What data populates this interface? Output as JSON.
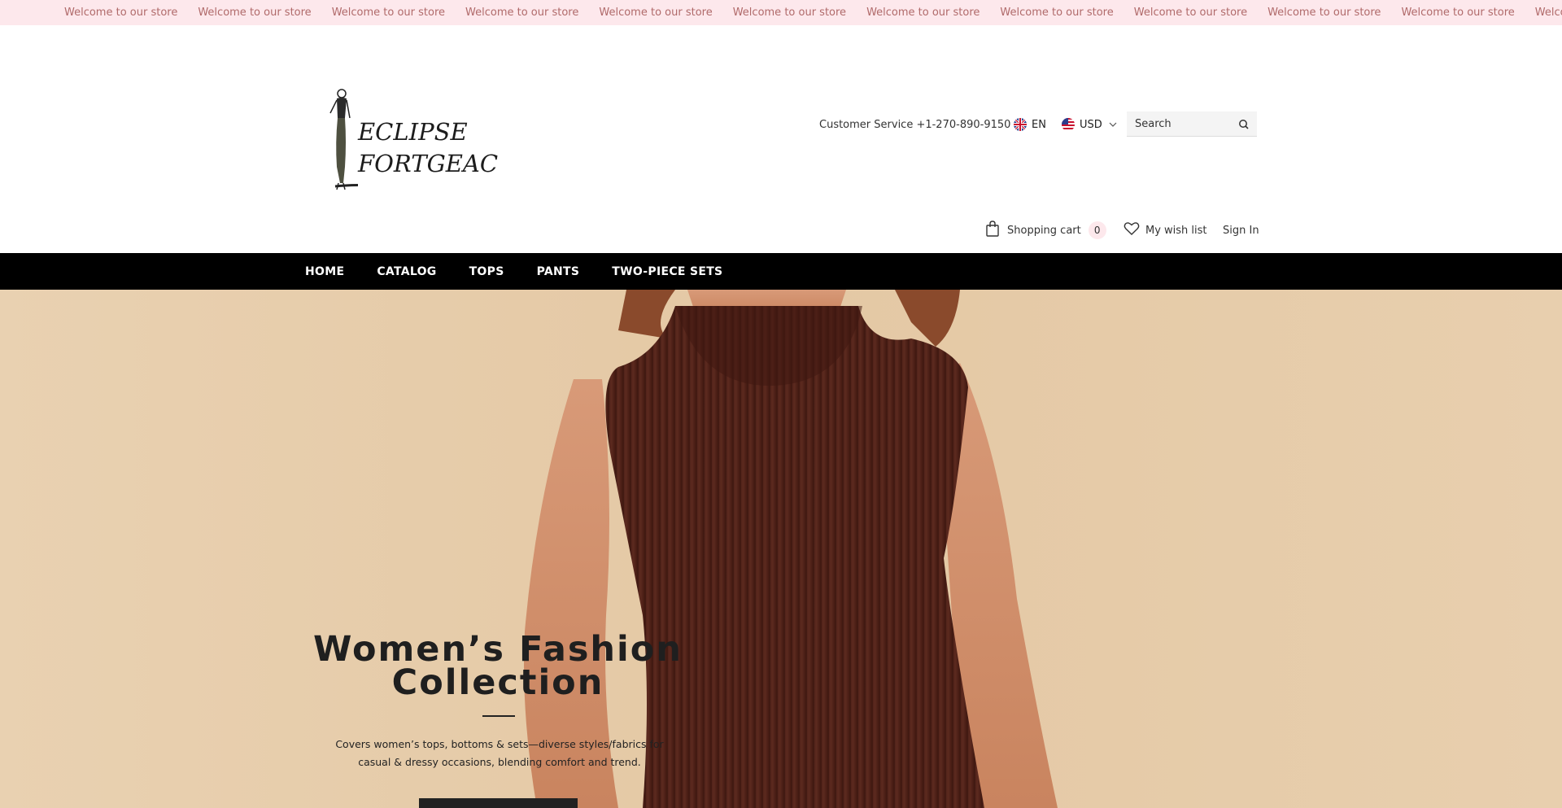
{
  "announcement": {
    "items": [
      "Welcome to our store",
      "Welcome to our store",
      "Welcome to our store",
      "Welcome to our store",
      "Welcome to our store",
      "Welcome to our store",
      "Welcome to our store",
      "Welcome to our store",
      "Welcome to our store",
      "Welcome to our store",
      "Welcome to our store",
      "Welcome to our store"
    ]
  },
  "header": {
    "logo_line1": "ECLIPSE",
    "logo_line2": "FORTGEAC",
    "customer_service": "Customer Service +1-270-890-9150",
    "language": "EN",
    "currency": "USD",
    "search_placeholder": "Search",
    "cart_label": "Shopping cart",
    "cart_count": "0",
    "wishlist_label": "My wish list",
    "signin_label": "Sign In"
  },
  "nav": {
    "items": [
      "HOME",
      "CATALOG",
      "TOPS",
      "PANTS",
      "TWO-PIECE SETS"
    ]
  },
  "hero": {
    "title_line1": "Women’s Fashion",
    "title_line2": "Collection",
    "desc_line1": "Covers women’s tops, bottoms & sets—diverse styles/fabrics for",
    "desc_line2": "casual & dressy occasions, blending comfort and trend."
  },
  "icons": {
    "search": "search-icon",
    "cart": "shopping-bag-icon",
    "wishlist": "heart-icon",
    "language_flag": "uk-flag-icon",
    "currency_flag": "us-flag-icon"
  },
  "colors": {
    "announcement_bg": "#fde8ec",
    "announcement_text": "#b06a6a",
    "nav_bg": "#000000",
    "cart_badge_bg": "#fde8ec"
  }
}
